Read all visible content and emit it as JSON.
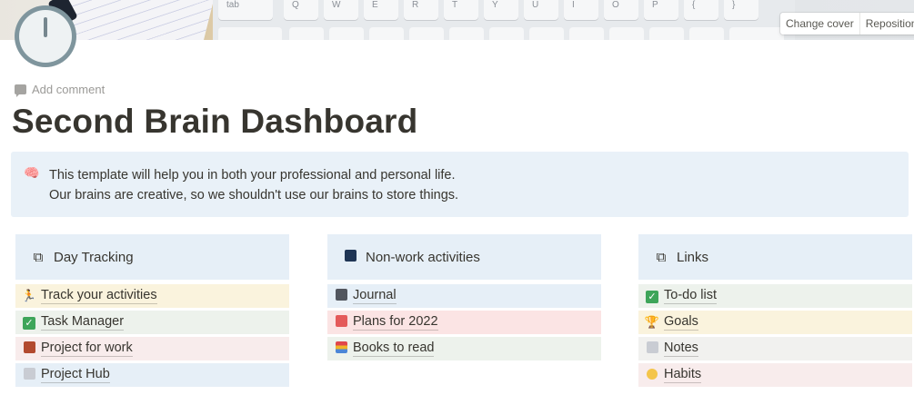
{
  "cover": {
    "change_label": "Change cover",
    "reposition_label": "Reposition",
    "keys": [
      "tab",
      "Q",
      "W",
      "E",
      "R",
      "T",
      "Y",
      "U",
      "I",
      "O",
      "P",
      "{",
      "}"
    ]
  },
  "page": {
    "icon": "clock-icon",
    "add_comment": "Add comment",
    "title": "Second Brain Dashboard"
  },
  "callout": {
    "icon": "brain-icon",
    "line1": "This template will help you in both your professional and personal life.",
    "line2": "Our brains are creative, so we shouldn't use our brains to store things."
  },
  "columns": [
    {
      "title": "Day Tracking",
      "icon": "binoculars-icon",
      "items": [
        {
          "label": "Track your activities",
          "icon": "running-person-icon",
          "bg": "#faf3dd"
        },
        {
          "label": "Task Manager",
          "icon": "check-mark-icon",
          "bg": "#edf2ec"
        },
        {
          "label": "Project for work",
          "icon": "briefcase-icon",
          "bg": "#f8ecec"
        },
        {
          "label": "Project Hub",
          "icon": "page-icon",
          "bg": "#e6eff7"
        }
      ]
    },
    {
      "title": "Non-work activities",
      "icon": "night-city-icon",
      "items": [
        {
          "label": "Journal",
          "icon": "notebook-icon",
          "bg": "#e6eff7"
        },
        {
          "label": "Plans for 2022",
          "icon": "calendar-icon",
          "bg": "#fbe4e4"
        },
        {
          "label": "Books to read",
          "icon": "books-icon",
          "bg": "#edf2ec"
        }
      ]
    },
    {
      "title": "Links",
      "icon": "binoculars-icon",
      "items": [
        {
          "label": "To-do list",
          "icon": "check-mark-icon",
          "bg": "#edf2ec"
        },
        {
          "label": "Goals",
          "icon": "trophy-icon",
          "bg": "#faf3dd"
        },
        {
          "label": "Notes",
          "icon": "notes-icon",
          "bg": "#f1f1ef"
        },
        {
          "label": "Habits",
          "icon": "smile-icon",
          "bg": "#f8ecec"
        }
      ]
    }
  ]
}
